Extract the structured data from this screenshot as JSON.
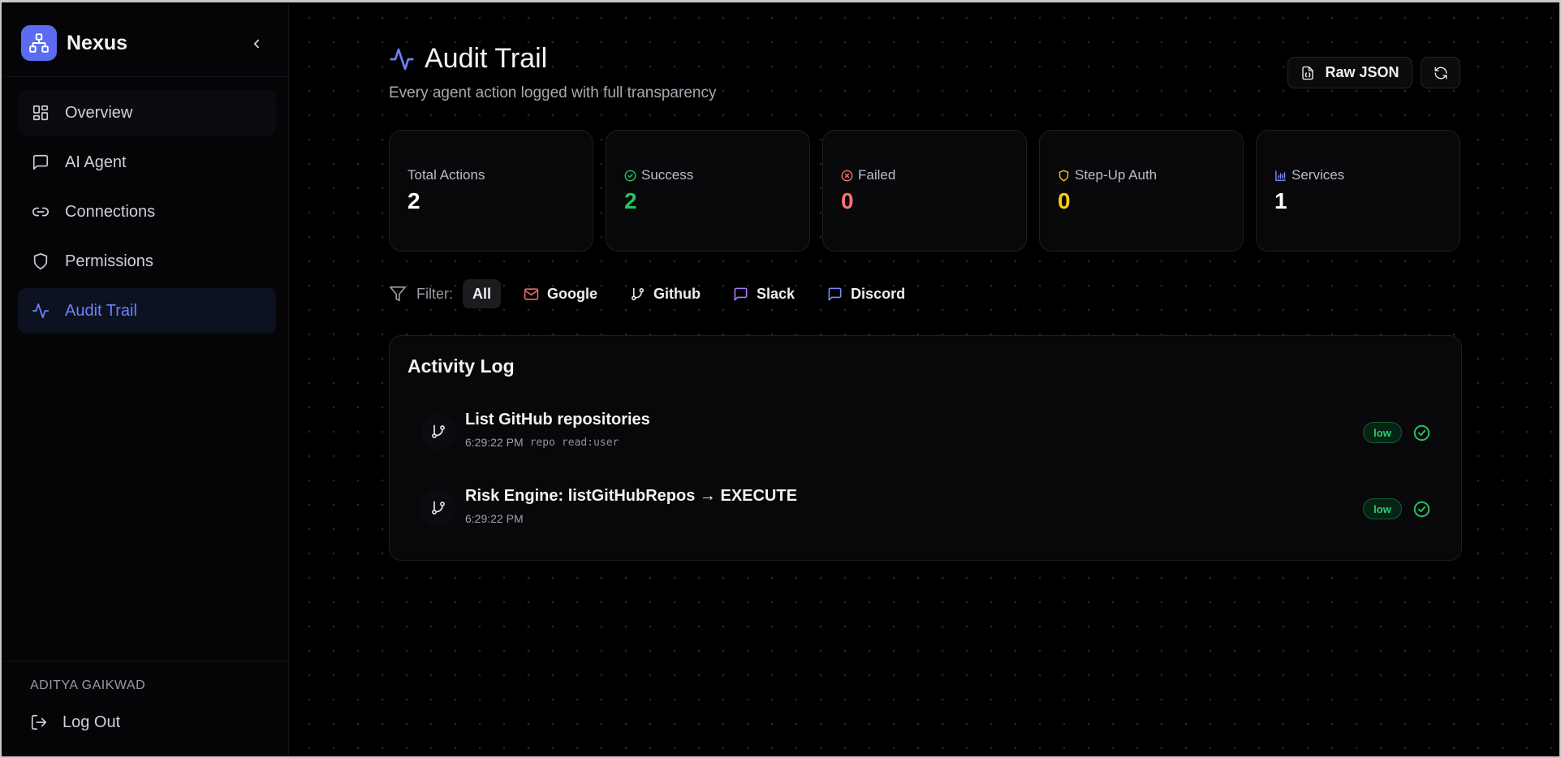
{
  "app": {
    "name": "Nexus"
  },
  "sidebar": {
    "items": [
      {
        "label": "Overview",
        "icon": "layout-dashboard-icon"
      },
      {
        "label": "AI Agent",
        "icon": "message-square-icon"
      },
      {
        "label": "Connections",
        "icon": "link-icon"
      },
      {
        "label": "Permissions",
        "icon": "shield-icon"
      },
      {
        "label": "Audit Trail",
        "icon": "activity-icon",
        "active": true
      }
    ],
    "user_name": "ADITYA GAIKWAD",
    "logout_label": "Log Out"
  },
  "header": {
    "title": "Audit Trail",
    "subtitle": "Every agent action logged with full transparency",
    "raw_json_label": "Raw JSON"
  },
  "stats": [
    {
      "label": "Total Actions",
      "value": "2",
      "color": "#ffffff"
    },
    {
      "label": "Success",
      "value": "2",
      "color": "#22c55e"
    },
    {
      "label": "Failed",
      "value": "0",
      "color": "#f87171"
    },
    {
      "label": "Step-Up Auth",
      "value": "0",
      "color": "#facc15"
    },
    {
      "label": "Services",
      "value": "1",
      "color": "#ffffff"
    }
  ],
  "filter": {
    "label": "Filter:",
    "options": [
      {
        "label": "All",
        "active": true
      },
      {
        "label": "Google",
        "icon": "mail-icon"
      },
      {
        "label": "Github",
        "icon": "git-branch-icon"
      },
      {
        "label": "Slack",
        "icon": "message-square-icon"
      },
      {
        "label": "Discord",
        "icon": "message-square-icon"
      }
    ]
  },
  "activity_log": {
    "title": "Activity Log",
    "entries": [
      {
        "title": "List GitHub repositories",
        "time": "6:29:22 PM",
        "scopes": [
          "repo",
          "read:user"
        ],
        "risk": "low",
        "status": "success"
      },
      {
        "title": "Risk Engine: listGitHubRepos → EXECUTE",
        "time": "6:29:22 PM",
        "scopes": [],
        "risk": "low",
        "status": "success"
      }
    ]
  },
  "colors": {
    "accent": "#5b6cf0",
    "success": "#22c55e",
    "danger": "#f87171",
    "warning": "#facc15"
  }
}
